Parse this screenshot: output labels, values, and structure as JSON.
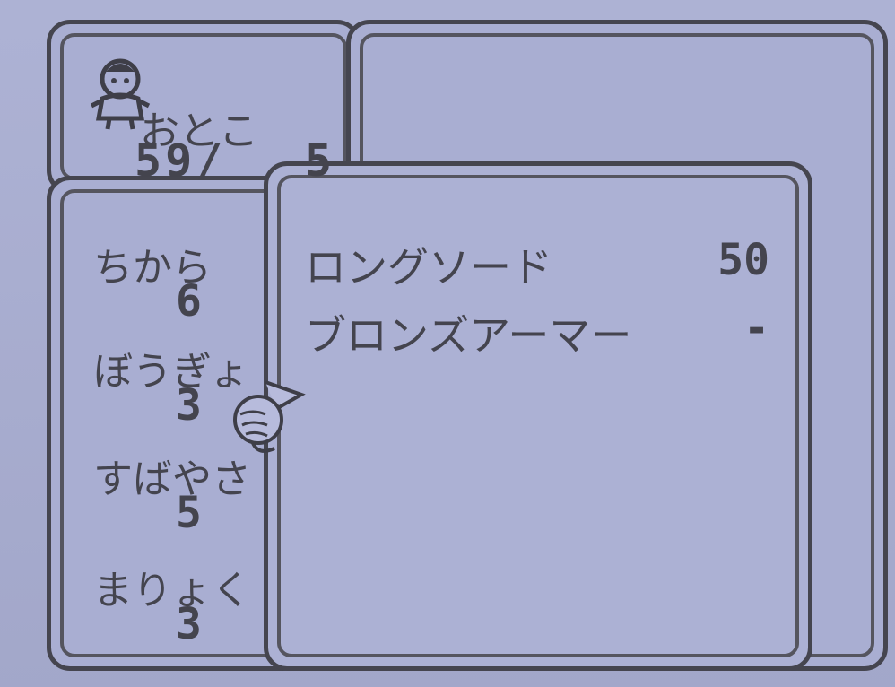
{
  "character": {
    "name": "おとこ",
    "hp_current": "59/",
    "hp_max": "5"
  },
  "stats": [
    {
      "label": "ちから",
      "value": "6"
    },
    {
      "label": "ぼうぎょ",
      "value": "3"
    },
    {
      "label": "すばやさ",
      "value": "5"
    },
    {
      "label": "まりょく",
      "value": "3"
    }
  ],
  "equipment": [
    {
      "name": "ロングソード",
      "value": "50"
    },
    {
      "name": "ブロンズアーマー",
      "value": "-"
    }
  ],
  "icons": {
    "avatar": "character-portrait-icon",
    "cursor": "pointing-hand-cursor-icon"
  },
  "colors": {
    "background": "#a9aed2",
    "border": "#45454f",
    "text": "#44444e"
  }
}
